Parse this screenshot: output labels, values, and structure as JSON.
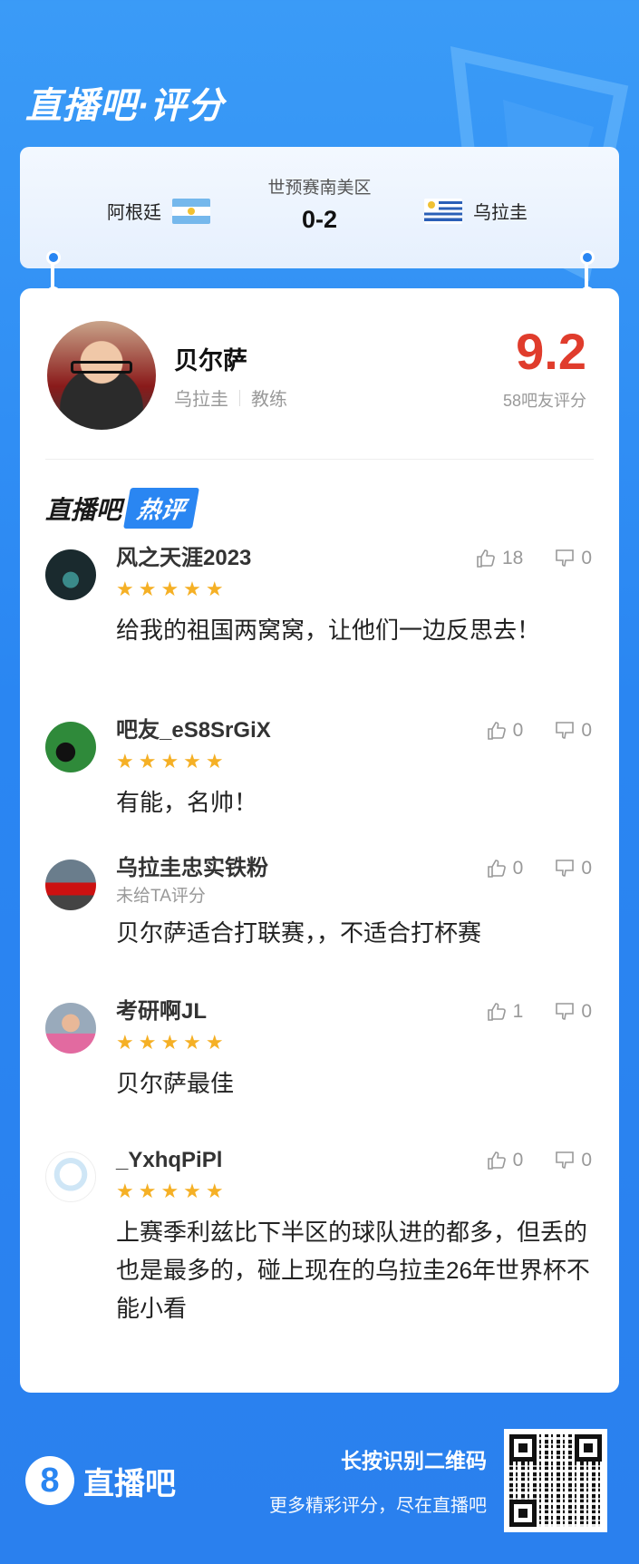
{
  "header": {
    "title": "直播吧·评分"
  },
  "match": {
    "home_team": "阿根廷",
    "away_team": "乌拉圭",
    "competition": "世预赛南美区",
    "score": "0-2"
  },
  "coach": {
    "name": "贝尔萨",
    "team": "乌拉圭",
    "role": "教练",
    "rating": "9.2",
    "rating_count": "58吧友评分"
  },
  "hot": {
    "brand": "直播吧",
    "badge": "热评"
  },
  "comments": [
    {
      "user": "风之天涯2023",
      "stars": "★★★★★",
      "likes": "18",
      "dislikes": "0",
      "text": "给我的祖国两窝窝，让他们一边反思去！"
    },
    {
      "user": "吧友_eS8SrGiX",
      "stars": "★★★★★",
      "likes": "0",
      "dislikes": "0",
      "text": "有能，名帅！"
    },
    {
      "user": "乌拉圭忠实铁粉",
      "norate": "未给TA评分",
      "likes": "0",
      "dislikes": "0",
      "text": "贝尔萨适合打联赛，，不适合打杯赛"
    },
    {
      "user": "考研啊JL",
      "stars": "★★★★★",
      "likes": "1",
      "dislikes": "0",
      "text": "贝尔萨最佳"
    },
    {
      "user": "_YxhqPiPl",
      "stars": "★★★★★",
      "likes": "0",
      "dislikes": "0",
      "text": "上赛季利兹比下半区的球队进的都多，但丢的也是最多的，碰上现在的乌拉圭26年世界杯不能小看"
    }
  ],
  "footer": {
    "logo_digit": "8",
    "logo_text": "直播吧",
    "cta_main": "长按识别二维码",
    "cta_sub": "更多精彩评分，尽在直播吧"
  },
  "colors": {
    "brand_blue": "#2a86f2",
    "rating_red": "#e03c2c",
    "star": "#f5b025"
  },
  "icons": [
    "like-icon",
    "dislike-icon",
    "qr-code"
  ]
}
